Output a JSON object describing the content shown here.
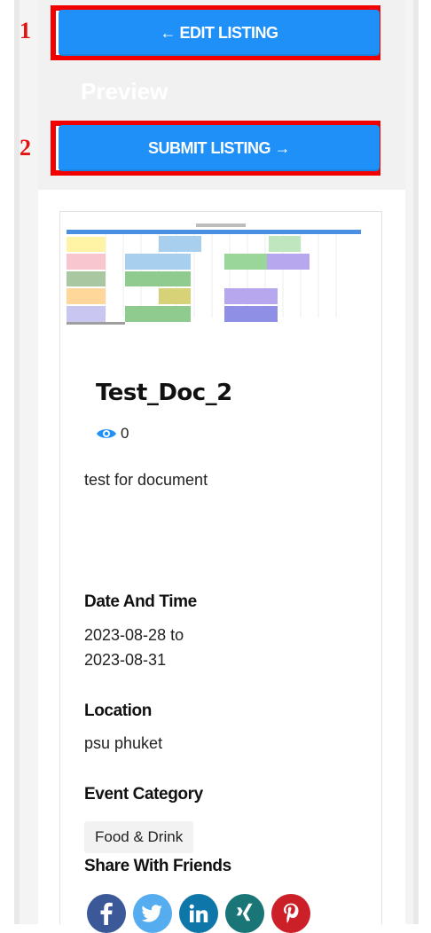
{
  "markers": [
    "1",
    "2"
  ],
  "buttons": {
    "edit_listing": "← EDIT LISTING",
    "submit_listing": "SUBMIT LISTING →"
  },
  "preview": {
    "heading": "Preview"
  },
  "listing": {
    "title": "Test_Doc_2",
    "view_count": "0",
    "description": "test for document",
    "date_heading": "Date And Time",
    "date_start": "2023-08-28 to",
    "date_end": "2023-08-31",
    "location_heading": "Location",
    "location_value": "psu phuket",
    "category_heading": "Event Category",
    "category_tag": "Food & Drink",
    "share_heading": "Share With Friends"
  },
  "social": [
    {
      "icon": "facebook-icon",
      "glyph": "f",
      "color": "#3b5998"
    },
    {
      "icon": "twitter-icon",
      "glyph": "t",
      "color": "#55acee"
    },
    {
      "icon": "linkedin-icon",
      "glyph": "in",
      "color": "#0e76a8"
    },
    {
      "icon": "xing-icon",
      "glyph": "X",
      "color": "#1a7576"
    },
    {
      "icon": "pinterest-icon",
      "glyph": "P",
      "color": "#cb2027"
    }
  ],
  "colors": {
    "button": "#1e90f7",
    "highlight": "#f20000",
    "marker": "#e3130f",
    "eye_icon": "#1e90f7"
  }
}
